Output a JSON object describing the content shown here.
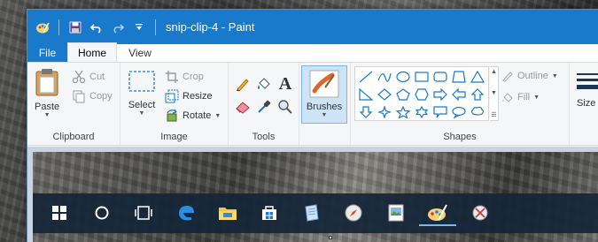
{
  "window": {
    "title": "snip-clip-4 - Paint"
  },
  "tabs": {
    "file": "File",
    "home": "Home",
    "view": "View"
  },
  "clipboard": {
    "paste": "Paste",
    "cut": "Cut",
    "copy": "Copy",
    "group": "Clipboard"
  },
  "image": {
    "select": "Select",
    "crop": "Crop",
    "resize": "Resize",
    "rotate": "Rotate",
    "group": "Image"
  },
  "tools": {
    "group": "Tools",
    "text_glyph": "A"
  },
  "brushes": {
    "label": "Brushes"
  },
  "shapes": {
    "outline": "Outline",
    "fill": "Fill",
    "group": "Shapes"
  },
  "size": {
    "label": "Size"
  },
  "colors": {
    "accent": "#1979ca",
    "taskbar": "#162638"
  },
  "taskbar_icons": [
    "windows-logo",
    "cortana",
    "task-view",
    "edge",
    "file-explorer",
    "store",
    "notepad",
    "safari-compass",
    "image-viewer",
    "paint",
    "snipping-tool"
  ]
}
